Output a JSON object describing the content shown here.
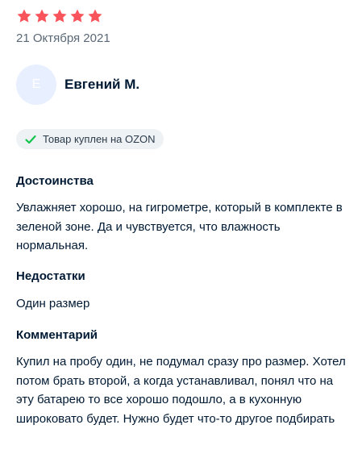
{
  "review": {
    "rating": 5,
    "rating_max": 5,
    "star_color": "#f9545b",
    "date": "21 Октября 2021",
    "author": {
      "initial": "Е",
      "name": "Евгений М."
    },
    "badge": {
      "icon": "check-icon",
      "text": "Товар куплен на OZON",
      "icon_color": "#10c44c"
    },
    "sections": {
      "advantages": {
        "title": "Достоинства",
        "text": "Увлажняет хорошо, на гигрометре, который в комплекте в зеленой зоне. Да и чувствуется, что влажность нормальная."
      },
      "disadvantages": {
        "title": "Недостатки",
        "text": "Один размер"
      },
      "comment": {
        "title": "Комментарий",
        "text": "Купил на пробу один, не подумал сразу про размер. Хотел потом брать второй, а когда устанавливал, понял что на эту батарею то все хорошо подошло, а в кухонную широковато будет. Нужно будет что-то другое подбирать"
      }
    }
  }
}
